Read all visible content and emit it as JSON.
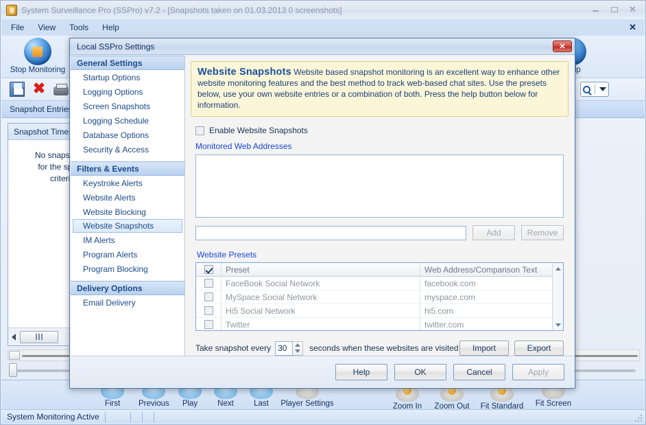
{
  "window": {
    "title": "System Surveillance Pro (SSPro) v7.2 - [Snapshots taken on 01.03.2013  0 screenshots]",
    "icon": "shield-icon",
    "controls": {
      "minimize": "minimize-icon",
      "maximize": "maximize-icon",
      "close": "close-icon"
    }
  },
  "menubar": {
    "items": [
      {
        "label": "File"
      },
      {
        "label": "View"
      },
      {
        "label": "Tools"
      },
      {
        "label": "Help"
      }
    ],
    "close_label": "✕"
  },
  "toolbar": {
    "stop_monitoring": "Stop Monitoring",
    "help": "Help",
    "icons": [
      {
        "name": "save-icon"
      },
      {
        "name": "delete-icon"
      },
      {
        "name": "print-icon"
      }
    ],
    "search": {
      "icon": "search-icon",
      "dropdown": "chevron-down-icon"
    }
  },
  "entries_header": "Snapshot Entries",
  "left_panel": {
    "header": "Snapshot Times",
    "empty_text_lines": [
      "No snapshots f",
      "for the specifi",
      "criteria"
    ]
  },
  "player_toolbar": {
    "items": [
      {
        "label": "First",
        "icon": "first-icon"
      },
      {
        "label": "Previous",
        "icon": "previous-icon"
      },
      {
        "label": "Play",
        "icon": "play-icon"
      },
      {
        "label": "Next",
        "icon": "next-icon"
      },
      {
        "label": "Last",
        "icon": "last-icon"
      },
      {
        "label": "Player Settings",
        "icon": "player-settings-icon"
      },
      {
        "label": "Zoom In",
        "icon": "zoom-in-icon"
      },
      {
        "label": "Zoom Out",
        "icon": "zoom-out-icon"
      },
      {
        "label": "Fit Standard",
        "icon": "fit-standard-icon"
      },
      {
        "label": "Fit Screen",
        "icon": "fit-screen-icon"
      }
    ]
  },
  "statusbar": {
    "text": "System Monitoring Active"
  },
  "dialog": {
    "title": "Local SSPro Settings",
    "close_label": "✕",
    "sidebar": {
      "groups": [
        {
          "title": "General Settings",
          "items": [
            {
              "label": "Startup Options",
              "selected": false
            },
            {
              "label": "Logging Options",
              "selected": false
            },
            {
              "label": "Screen Snapshots",
              "selected": false
            },
            {
              "label": "Logging Schedule",
              "selected": false
            },
            {
              "label": "Database Options",
              "selected": false
            },
            {
              "label": "Security & Access",
              "selected": false
            }
          ]
        },
        {
          "title": "Filters & Events",
          "items": [
            {
              "label": "Keystroke Alerts",
              "selected": false
            },
            {
              "label": "Website Alerts",
              "selected": false
            },
            {
              "label": "Website Blocking",
              "selected": false
            },
            {
              "label": "Website Snapshots",
              "selected": true
            },
            {
              "label": "IM Alerts",
              "selected": false
            },
            {
              "label": "Program Alerts",
              "selected": false
            },
            {
              "label": "Program Blocking",
              "selected": false
            }
          ]
        },
        {
          "title": "Delivery Options",
          "items": [
            {
              "label": "Email Delivery",
              "selected": false
            }
          ]
        }
      ]
    },
    "banner": {
      "heading": "Website Snapshots",
      "body": " Website based snapshot monitoring is an excellent way to enhance other website monitoring features and the best method to track web-based chat sites. Use the presets below, use your own website entries or a combination of both. Press the help button below for information."
    },
    "enable_checkbox": {
      "label": "Enable Website Snapshots",
      "checked": false
    },
    "monitored_label": "Monitored Web Addresses",
    "monitored_list": [],
    "address_input": {
      "value": "",
      "placeholder": ""
    },
    "add_button": {
      "label": "Add",
      "disabled": true
    },
    "remove_button": {
      "label": "Remove",
      "disabled": true
    },
    "presets_label": "Website Presets",
    "presets_table": {
      "columns": [
        "",
        "Preset",
        "Web Address/Comparison Text"
      ],
      "header_checked": true,
      "rows": [
        {
          "checked": false,
          "preset": "FaceBook Social Network",
          "address": "facebook.com"
        },
        {
          "checked": false,
          "preset": "MySpace Social Network",
          "address": "myspace.com"
        },
        {
          "checked": false,
          "preset": "Hi5 Social Network",
          "address": "hi5.com"
        },
        {
          "checked": false,
          "preset": "Twitter",
          "address": "twitter.com"
        }
      ]
    },
    "interval": {
      "prefix": "Take snapshot every",
      "value": "30",
      "suffix": "seconds when these websites are visited"
    },
    "import_button": {
      "label": "Import"
    },
    "export_button": {
      "label": "Export"
    },
    "footer": {
      "help": "Help",
      "ok": "OK",
      "cancel": "Cancel",
      "apply": "Apply",
      "apply_disabled": true
    }
  },
  "colors": {
    "accent_blue": "#1a46d8",
    "sidebar_link": "#1b4a8a",
    "banner_bg": "#fbf6d8",
    "title_text": "#8a97a8",
    "close_red": "#d44f45"
  }
}
